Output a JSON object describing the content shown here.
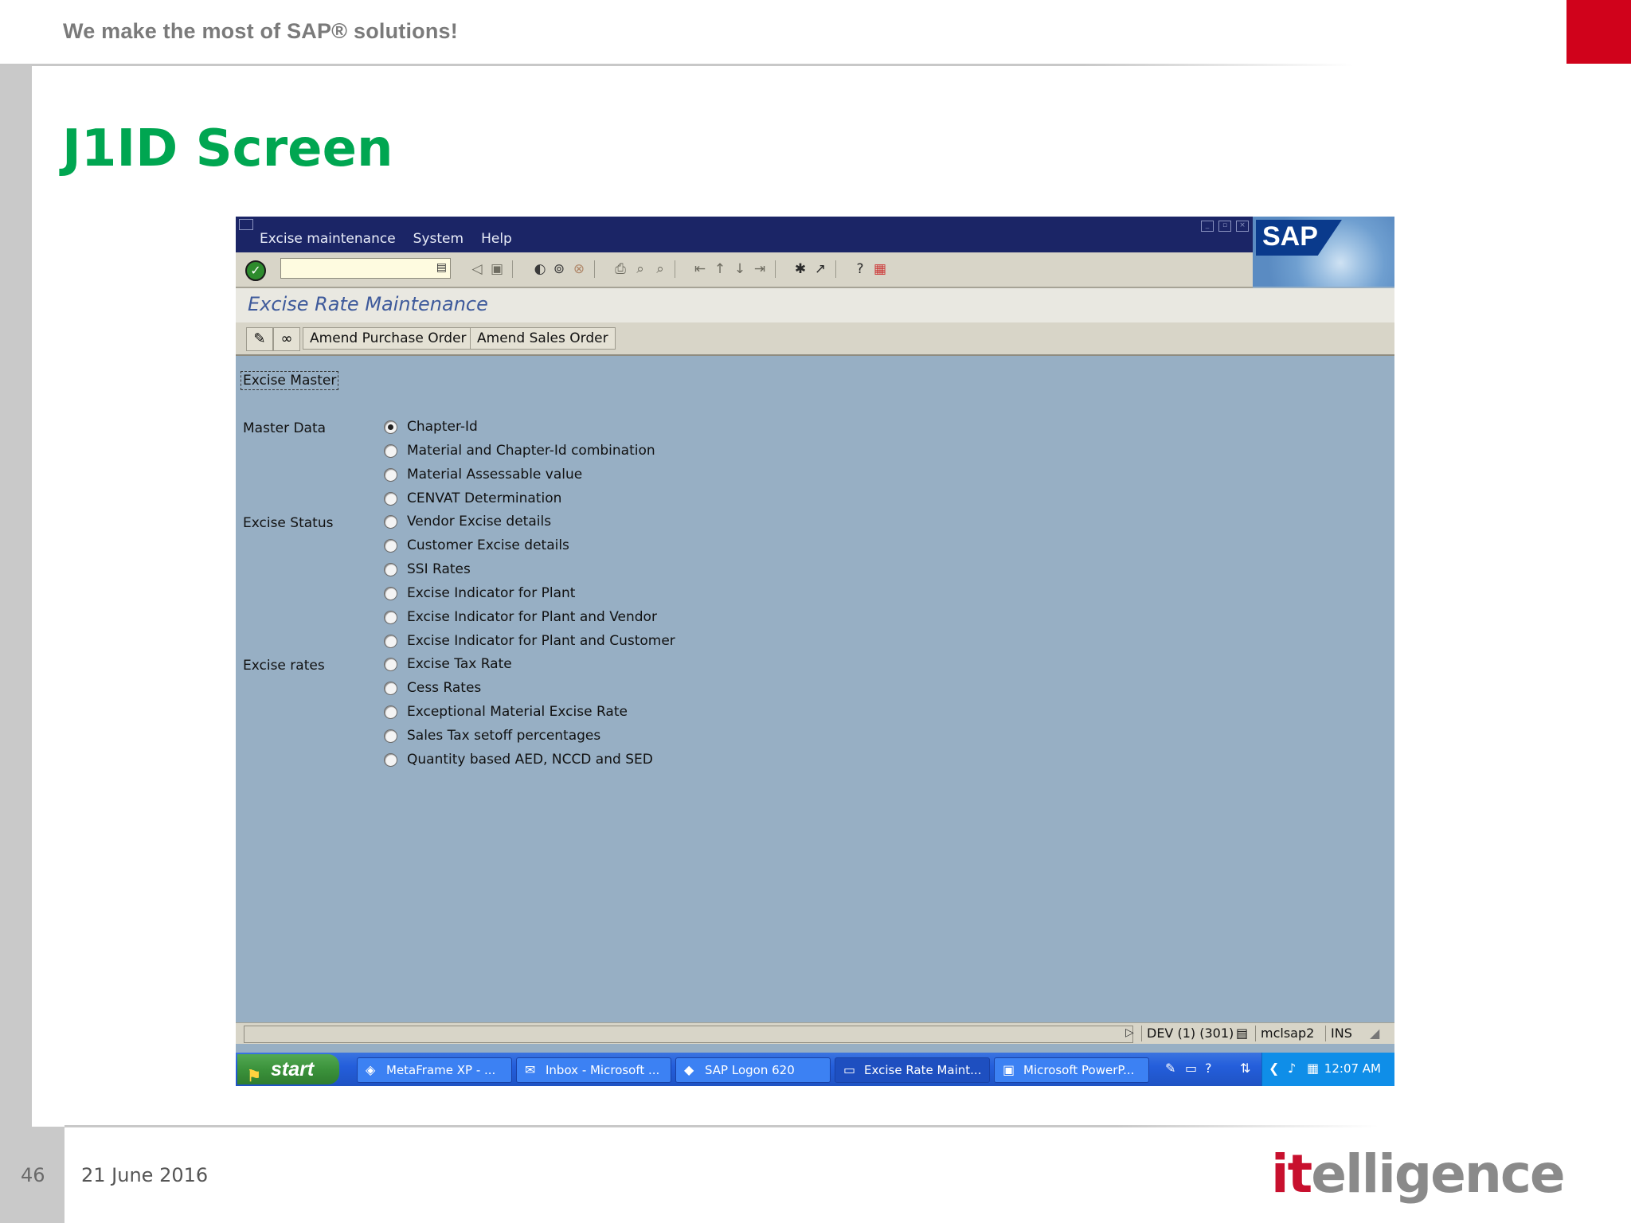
{
  "slide": {
    "tagline": "We make the most of SAP® solutions!",
    "title": "J1ID Screen",
    "page_number": "46",
    "date": "21 June 2016",
    "logo_it": "it",
    "logo_rest": "elligence"
  },
  "sap_window": {
    "menu": [
      "Excise maintenance",
      "System",
      "Help"
    ],
    "logo_text": "SAP",
    "command_field": {
      "value": ""
    },
    "screen_title": "Excise Rate Maintenance",
    "app_buttons": [
      "Amend Purchase Order",
      "Amend Sales Order"
    ],
    "group_label": "Excise Master",
    "sections": [
      {
        "label": "Master Data",
        "options": [
          "Chapter-Id",
          "Material and Chapter-Id combination",
          "Material Assessable value",
          "CENVAT Determination"
        ]
      },
      {
        "label": "Excise Status",
        "options": [
          "Vendor Excise details",
          "Customer Excise details",
          "SSI Rates",
          "Excise Indicator for Plant",
          "Excise Indicator for Plant and Vendor",
          "Excise Indicator for Plant and Customer"
        ]
      },
      {
        "label": "Excise rates",
        "options": [
          "Excise Tax Rate",
          "Cess Rates",
          "Exceptional Material Excise Rate",
          "Sales Tax setoff percentages",
          "Quantity based AED, NCCD and SED"
        ]
      }
    ],
    "selected_option": "Chapter-Id",
    "status": {
      "system": "DEV (1) (301)",
      "server": "mclsap2",
      "mode": "INS"
    }
  },
  "taskbar": {
    "start_label": "start",
    "tasks": [
      "MetaFrame XP - ...",
      "Inbox - Microsoft ...",
      "SAP Logon 620",
      "Excise Rate Maint...",
      "Microsoft PowerP..."
    ],
    "active_task": "Excise Rate Maint...",
    "clock": "12:07 AM"
  },
  "colors": {
    "title_green": "#00a651",
    "brand_red": "#d0021b",
    "sap_bg": "#97afc4",
    "sap_titlebar": "#1b2566"
  }
}
